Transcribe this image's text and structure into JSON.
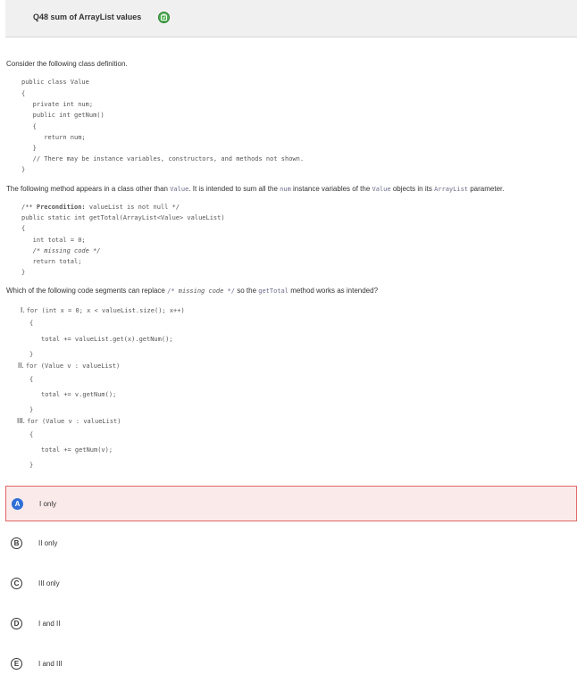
{
  "header": {
    "title": "Q48 sum of ArrayList values",
    "help_icon": "help-icon"
  },
  "prompt": {
    "intro": "Consider the following class definition.",
    "class_code": [
      "public class Value",
      "{",
      "   private int num;",
      "   public int getNum()",
      "   {",
      "      return num;",
      "   }",
      "   // There may be instance variables, constructors, and methods not shown.",
      "}"
    ],
    "method_intro": {
      "part1": "The following method appears in a class other than ",
      "code1": "Value",
      "part2": ".  It is intended to sum all the ",
      "code2": "num",
      "part3": " instance variables of the ",
      "code3": "Value",
      "part4": " objects in its ",
      "code4": "ArrayList",
      "part5": " parameter."
    },
    "method_code": {
      "precondition_open": "/** ",
      "precondition_label": "Precondition:",
      "precondition_rest": " valueList is not null */",
      "signature": "public static int getTotal(ArrayList<Value> valueList)",
      "open_brace": "{",
      "line1": "   int total = 0;",
      "line2": "   /* missing code */",
      "line3": "   return total;",
      "close_brace": "}"
    },
    "question": {
      "part1": "Which of the following code segments can replace ",
      "code_open": "/* ",
      "code_italic": "missing code",
      "code_close": " */",
      "part2": " so the ",
      "code2": "getTotal",
      "part3": " method works as intended?"
    },
    "segments": [
      {
        "label": "I.",
        "header": "for (int x = 0; x < valueList.size(); x++)",
        "open": "{",
        "body": "total += valueList.get(x).getNum();",
        "close": "}"
      },
      {
        "label": "II.",
        "header": "for (Value v : valueList)",
        "open": "{",
        "body": "total += v.getNum();",
        "close": "}"
      },
      {
        "label": "III.",
        "header": "for (Value v : valueList)",
        "open": "{",
        "body": "total += getNum(v);",
        "close": "}"
      }
    ]
  },
  "choices": [
    {
      "letter": "A",
      "label": "I only",
      "selected": true
    },
    {
      "letter": "B",
      "label": "II only",
      "selected": false
    },
    {
      "letter": "C",
      "label": "III only",
      "selected": false
    },
    {
      "letter": "D",
      "label": "I and II",
      "selected": false
    },
    {
      "letter": "E",
      "label": "I and III",
      "selected": false
    }
  ],
  "colors": {
    "selected_bg": "#fbeaea",
    "selected_border": "#e06666",
    "selected_badge": "#2f6fd6",
    "help_icon": "#4caf50"
  }
}
